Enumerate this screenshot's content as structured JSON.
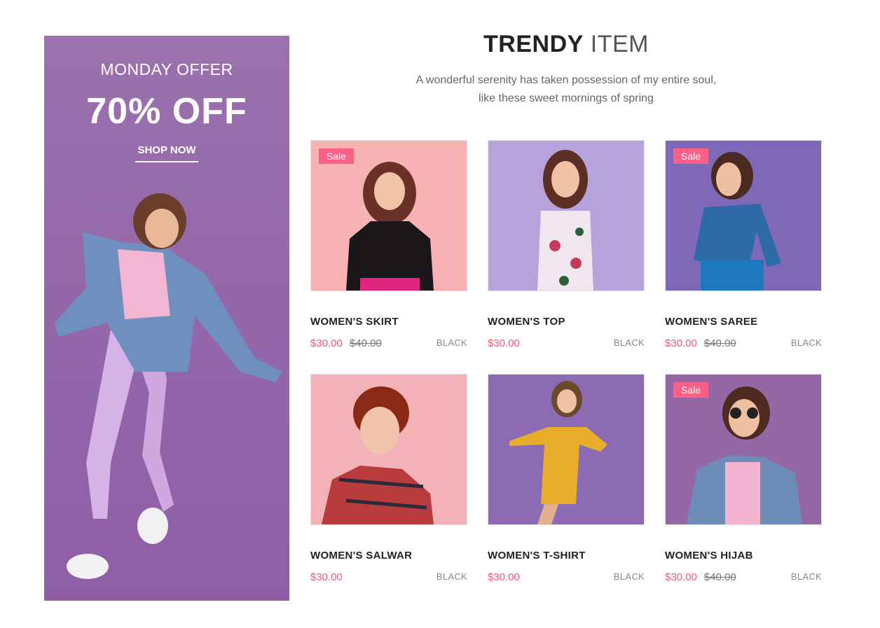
{
  "promo": {
    "subtitle": "MONDAY OFFER",
    "title": "70% OFF",
    "button_label": "SHOP NOW",
    "background": "#9466aa"
  },
  "section": {
    "title_strong": "TRENDY",
    "title_light": "ITEM",
    "description": "A wonderful serenity has taken possession of my entire soul, like these sweet mornings of spring"
  },
  "products": [
    {
      "name": "WOMEN'S SKIRT",
      "price": "$30.00",
      "old_price": "$40.00",
      "color": "BLACK",
      "sale": "Sale",
      "bg": "#f7b2b4"
    },
    {
      "name": "WOMEN'S TOP",
      "price": "$30.00",
      "old_price": "",
      "color": "BLACK",
      "sale": "",
      "bg": "#b7a2dc"
    },
    {
      "name": "WOMEN'S SAREE",
      "price": "$30.00",
      "old_price": "$40.00",
      "color": "BLACK",
      "sale": "Sale",
      "bg": "#7e68b8"
    },
    {
      "name": "WOMEN'S SALWAR",
      "price": "$30.00",
      "old_price": "",
      "color": "BLACK",
      "sale": "",
      "bg": "#f3b1b8"
    },
    {
      "name": "WOMEN'S T-SHIRT",
      "price": "$30.00",
      "old_price": "",
      "color": "BLACK",
      "sale": "",
      "bg": "#8c6ab4"
    },
    {
      "name": "WOMEN'S HIJAB",
      "price": "$30.00",
      "old_price": "$40.00",
      "color": "BLACK",
      "sale": "Sale",
      "bg": "#9468a4"
    }
  ],
  "colors": {
    "accent": "#f3577b",
    "sale_badge": "#fd5f86"
  }
}
